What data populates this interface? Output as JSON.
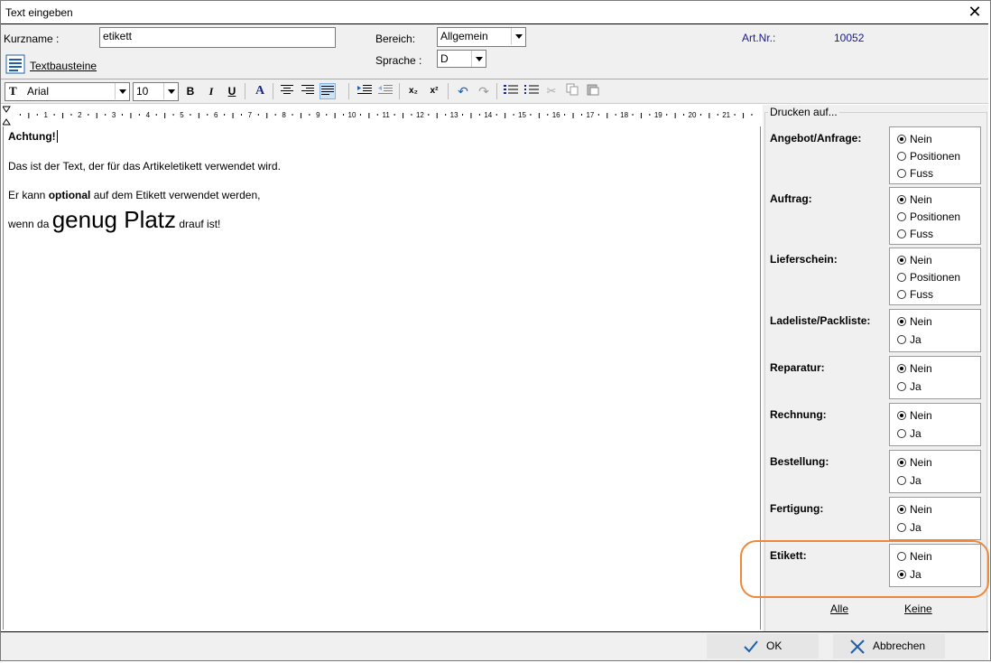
{
  "window": {
    "title": "Text eingeben"
  },
  "header": {
    "kurzname_label": "Kurzname :",
    "kurzname_value": "etikett",
    "textbausteine_label": "Textbausteine",
    "bereich_label": "Bereich:",
    "bereich_value": "Allgemein",
    "sprache_label": "Sprache :",
    "sprache_value": "D",
    "artnr_label": "Art.Nr.:",
    "artnr_value": "10052"
  },
  "toolbar": {
    "font": "Arial",
    "size": "10",
    "bold": "B",
    "italic": "I",
    "underline": "U",
    "sub": "x₂",
    "sup": "x²"
  },
  "ruler": {
    "ticks": [
      "1",
      "2",
      "3",
      "4",
      "5",
      "6",
      "7",
      "8",
      "9",
      "10",
      "11",
      "12",
      "13",
      "14",
      "15",
      "16",
      "17",
      "18",
      "19",
      "20",
      "21"
    ]
  },
  "editor": {
    "line1": "Achtung!",
    "line2": "Das ist der Text, der für das Artikeletikett verwendet wird.",
    "line3_a": "Er kann ",
    "line3_b": "optional",
    "line3_c": " auf dem Etikett verwendet werden,",
    "line4_a": "wenn da ",
    "line4_b": "genug Platz",
    "line4_c": " drauf ist!"
  },
  "side": {
    "title": "Drucken auf...",
    "groups": [
      {
        "label": "Angebot/Anfrage:",
        "options": [
          "Nein",
          "Positionen",
          "Fuss"
        ],
        "selected": 0
      },
      {
        "label": "Auftrag:",
        "options": [
          "Nein",
          "Positionen",
          "Fuss"
        ],
        "selected": 0
      },
      {
        "label": "Lieferschein:",
        "options": [
          "Nein",
          "Positionen",
          "Fuss"
        ],
        "selected": 0
      },
      {
        "label": "Ladeliste/Packliste:",
        "options": [
          "Nein",
          "Ja"
        ],
        "selected": 0
      },
      {
        "label": "Reparatur:",
        "options": [
          "Nein",
          "Ja"
        ],
        "selected": 0
      },
      {
        "label": "Rechnung:",
        "options": [
          "Nein",
          "Ja"
        ],
        "selected": 0
      },
      {
        "label": "Bestellung:",
        "options": [
          "Nein",
          "Ja"
        ],
        "selected": 0
      },
      {
        "label": "Fertigung:",
        "options": [
          "Nein",
          "Ja"
        ],
        "selected": 0
      },
      {
        "label": "Etikett:",
        "options": [
          "Nein",
          "Ja"
        ],
        "selected": 1
      }
    ],
    "alle": "Alle",
    "keine": "Keine"
  },
  "footer": {
    "ok": "OK",
    "cancel": "Abbrechen"
  },
  "colors": {
    "highlight": "#f0883a",
    "artnr": "#1a1a8c",
    "check": "#1f5fa8"
  }
}
